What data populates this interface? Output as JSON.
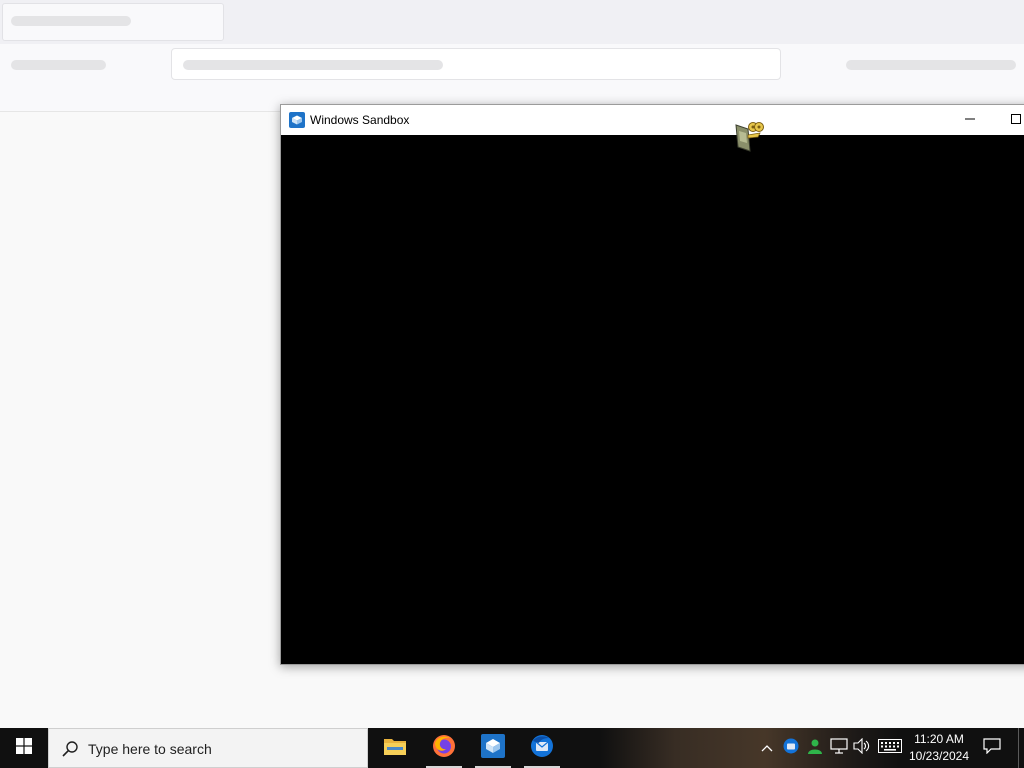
{
  "window": {
    "title": "Windows Sandbox",
    "minimize": "minimize",
    "maximize": "maximize"
  },
  "taskbar": {
    "search_placeholder": "Type here to search",
    "apps": [
      {
        "name": "File Explorer",
        "icon": "folder-icon"
      },
      {
        "name": "Firefox",
        "icon": "firefox-icon"
      },
      {
        "name": "Windows Sandbox",
        "icon": "sandbox-icon"
      },
      {
        "name": "Thunderbird",
        "icon": "thunderbird-icon"
      }
    ],
    "tray": {
      "time": "11:20 AM",
      "date": "10/23/2024"
    }
  },
  "colors": {
    "taskbar": "#101010",
    "accent": "#0078d4",
    "window_content": "#000000"
  }
}
